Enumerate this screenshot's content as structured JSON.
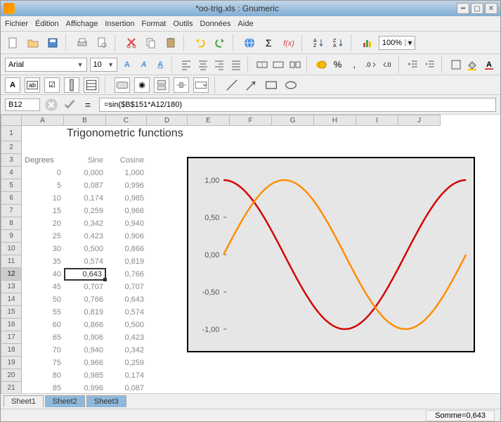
{
  "window": {
    "title": "*oo-trig.xls : Gnumeric"
  },
  "menu": {
    "file": "Fichier",
    "edit": "Édition",
    "view": "Affichage",
    "insert": "Insertion",
    "format": "Format",
    "tools": "Outils",
    "data": "Données",
    "help": "Aide"
  },
  "zoom": "100%",
  "font": {
    "name": "Arial",
    "size": "10"
  },
  "cellref": "B12",
  "formula": "=sin($B$151*A12/180)",
  "title_cell": "Trigonometric functions",
  "headers": {
    "degrees": "Degrees",
    "sine": "Sine",
    "cosine": "Cosine"
  },
  "cols": [
    "A",
    "B",
    "C",
    "D",
    "E",
    "F",
    "G",
    "H",
    "I",
    "J"
  ],
  "rows": [
    {
      "deg": "0",
      "sin": "0,000",
      "cos": "1,000"
    },
    {
      "deg": "5",
      "sin": "0,087",
      "cos": "0,996"
    },
    {
      "deg": "10",
      "sin": "0,174",
      "cos": "0,985"
    },
    {
      "deg": "15",
      "sin": "0,259",
      "cos": "0,966"
    },
    {
      "deg": "20",
      "sin": "0,342",
      "cos": "0,940"
    },
    {
      "deg": "25",
      "sin": "0,423",
      "cos": "0,906"
    },
    {
      "deg": "30",
      "sin": "0,500",
      "cos": "0,866"
    },
    {
      "deg": "35",
      "sin": "0,574",
      "cos": "0,819"
    },
    {
      "deg": "40",
      "sin": "0,643",
      "cos": "0,766"
    },
    {
      "deg": "45",
      "sin": "0,707",
      "cos": "0,707"
    },
    {
      "deg": "50",
      "sin": "0,766",
      "cos": "0,643"
    },
    {
      "deg": "55",
      "sin": "0,819",
      "cos": "0,574"
    },
    {
      "deg": "60",
      "sin": "0,866",
      "cos": "0,500"
    },
    {
      "deg": "65",
      "sin": "0,906",
      "cos": "0,423"
    },
    {
      "deg": "70",
      "sin": "0,940",
      "cos": "0,342"
    },
    {
      "deg": "75",
      "sin": "0,966",
      "cos": "0,259"
    },
    {
      "deg": "80",
      "sin": "0,985",
      "cos": "0,174"
    },
    {
      "deg": "85",
      "sin": "0,996",
      "cos": "0,087"
    }
  ],
  "chart_data": {
    "type": "line",
    "ylim": [
      -1.2,
      1.2
    ],
    "yticks": [
      "1,00",
      "0,50",
      "0,00",
      "-0,50",
      "-1,00"
    ],
    "series": [
      {
        "name": "Sine",
        "color": "#ff8c00"
      },
      {
        "name": "Cosine",
        "color": "#d40000"
      }
    ],
    "x_range_deg": [
      0,
      360
    ]
  },
  "tabs": [
    "Sheet1",
    "Sheet2",
    "Sheet3"
  ],
  "status": "Somme=0,643"
}
